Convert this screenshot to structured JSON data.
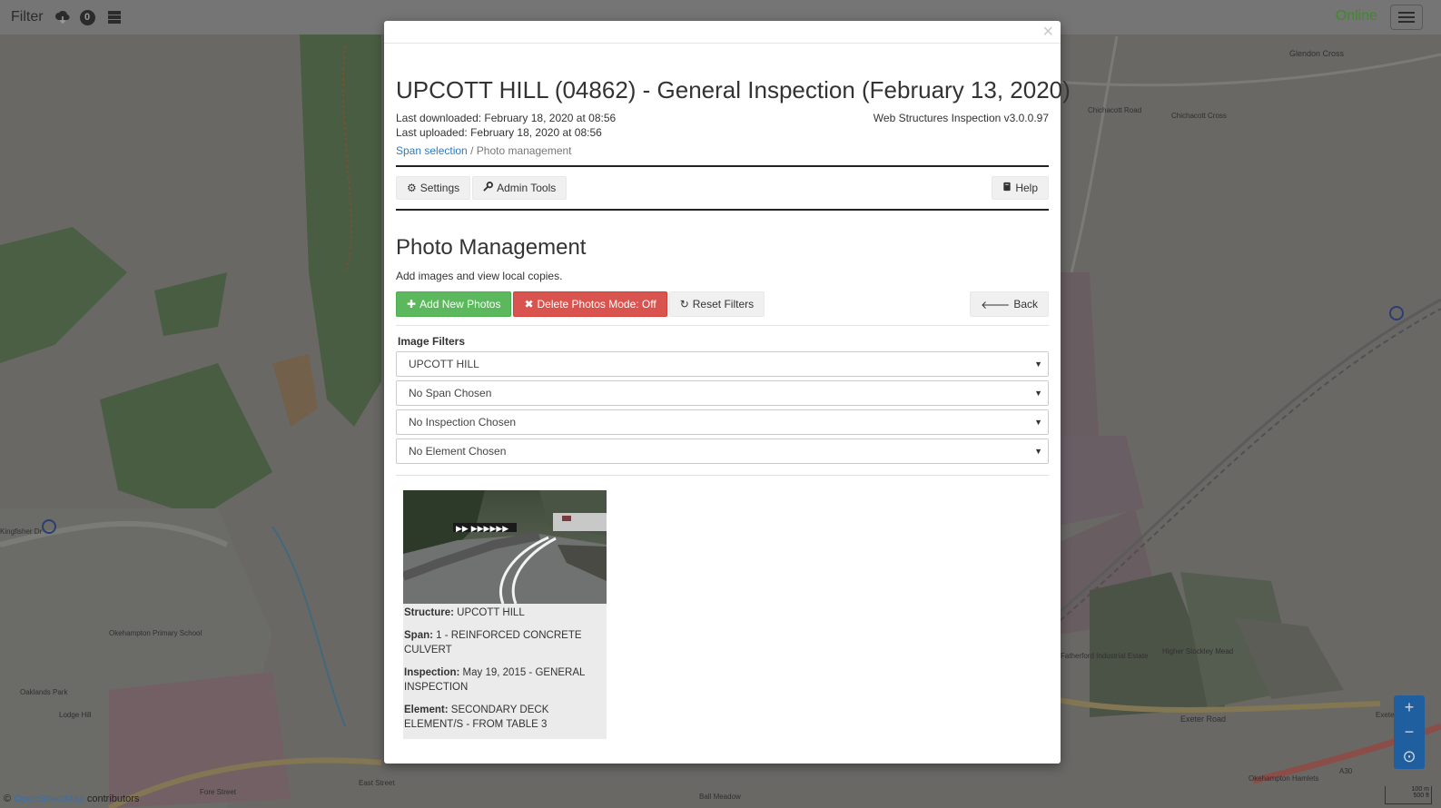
{
  "topbar": {
    "filter_label": "Filter",
    "badge_count": "0",
    "status": "Online",
    "icons": [
      "cloud-download-icon",
      "badge-count",
      "database-icon",
      "hamburger-menu-icon"
    ]
  },
  "modal": {
    "title": "UPCOTT HILL (04862) - General Inspection (February 13, 2020)",
    "last_downloaded": "Last downloaded: February 18, 2020 at 08:56",
    "last_uploaded": "Last uploaded: February 18, 2020 at 08:56",
    "version": "Web Structures Inspection v3.0.0.97",
    "breadcrumb": {
      "link": "Span selection",
      "separator": "/",
      "current": "Photo management"
    },
    "toolbar": {
      "settings_label": "Settings",
      "admin_tools_label": "Admin Tools",
      "help_label": "Help"
    },
    "section": {
      "title": "Photo Management",
      "subtitle": "Add images and view local copies."
    },
    "actions": {
      "add_photos_label": "Add New Photos",
      "delete_mode_label": "Delete Photos Mode: Off",
      "reset_filters_label": "Reset Filters",
      "back_label": "Back"
    },
    "filters": {
      "label": "Image Filters",
      "structure": "UPCOTT HILL",
      "span": "No Span Chosen",
      "inspection": "No Inspection Chosen",
      "element": "No Element Chosen"
    },
    "photos": [
      {
        "structure_label": "Structure:",
        "structure": "UPCOTT HILL",
        "span_label": "Span:",
        "span": "1 - REINFORCED CONCRETE CULVERT",
        "inspection_label": "Inspection:",
        "inspection": "May 19, 2015 - GENERAL INSPECTION",
        "element_label": "Element:",
        "element": "SECONDARY DECK ELEMENT/S - FROM TABLE 3"
      }
    ]
  },
  "map": {
    "attribution_symbol": "©",
    "attribution_link": "OpenStreetMap",
    "attribution_suffix": "contributors",
    "scale_top": "100 m",
    "scale_bottom": "500 ft",
    "labels": {
      "glendon_cross": "Glendon Cross",
      "chichacott_road": "Chichacott Road",
      "chichacott_cross": "Chichacott Cross",
      "exeter_road": "Exeter Road",
      "exeter_road_2": "Exeter Road",
      "okehampton_school": "Okehampton Primary School",
      "east_street": "East Street",
      "fore_street": "Fore Street",
      "industrial_estate": "Fatherford Industrial Estate",
      "a30": "A30",
      "okehampton_hamlets": "Okehampton Hamlets",
      "kingfisher_drive": "Kingfisher Dr",
      "lodge_hill": "Lodge Hill",
      "oaklands_park": "Oaklands Park",
      "ball_meadow": "Ball Meadow",
      "higher_stockley_mead": "Higher Stockley Mead"
    }
  },
  "colors": {
    "accent_green": "#5cb85c",
    "accent_red": "#d9534f",
    "link_blue": "#337ab7",
    "online_green": "#3f8a2a"
  }
}
